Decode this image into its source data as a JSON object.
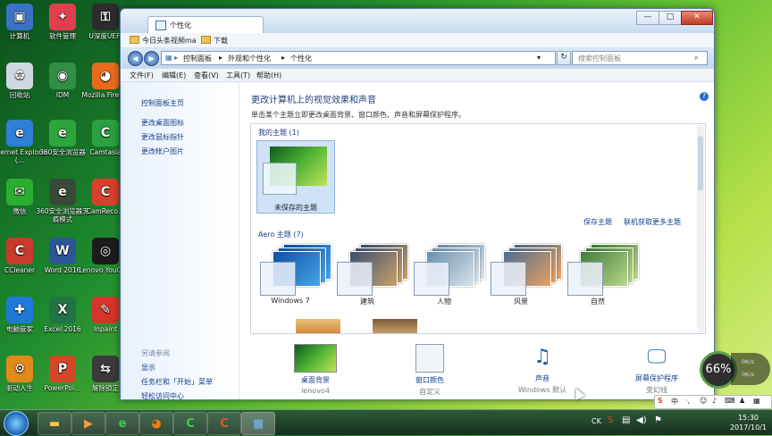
{
  "desktop_icons": [
    {
      "label": "计算机",
      "icon": "computer-icon",
      "color": "#3a72c5",
      "glyph": "▣"
    },
    {
      "label": "软件管理",
      "icon": "software-manager-icon",
      "color": "#e0404c",
      "glyph": "✦"
    },
    {
      "label": "U深度UEFI",
      "icon": "usb-icon",
      "color": "#2c2c2c",
      "glyph": "⚿"
    },
    {
      "label": "回收站",
      "icon": "recycle-bin-icon",
      "color": "#cfd8e0",
      "glyph": "♻"
    },
    {
      "label": "IDM",
      "icon": "idm-icon",
      "color": "#2f8f43",
      "glyph": "◉"
    },
    {
      "label": "Mozilla Firefox",
      "icon": "firefox-icon",
      "color": "#e86a1d",
      "glyph": "◕"
    },
    {
      "label": "Internet Explorer (…",
      "icon": "ie-icon",
      "color": "#2f7fd6",
      "glyph": "e"
    },
    {
      "label": "360安全浏览器",
      "icon": "browser-360-icon",
      "color": "#2ea43c",
      "glyph": "e"
    },
    {
      "label": "Camtasia",
      "icon": "camtasia-icon",
      "color": "#2ba040",
      "glyph": "C"
    },
    {
      "label": "微信",
      "icon": "wechat-icon",
      "color": "#2aae30",
      "glyph": "✉"
    },
    {
      "label": "360安全浏览器无痕模式",
      "icon": "browser-360-private-icon",
      "color": "#3a4a3a",
      "glyph": "e"
    },
    {
      "label": "CamReco…",
      "icon": "camrecorder-icon",
      "color": "#d9402b",
      "glyph": "C"
    },
    {
      "label": "CCleaner",
      "icon": "ccleaner-icon",
      "color": "#c83a2a",
      "glyph": "C"
    },
    {
      "label": "Word 2016",
      "icon": "word-icon",
      "color": "#2b579a",
      "glyph": "W"
    },
    {
      "label": "Lenovo YouCam",
      "icon": "youcam-icon",
      "color": "#1c1c1c",
      "glyph": "◎"
    },
    {
      "label": "电脑管家",
      "icon": "pc-manager-icon",
      "color": "#1e7ad6",
      "glyph": "✚"
    },
    {
      "label": "Excel 2016",
      "icon": "excel-icon",
      "color": "#217346",
      "glyph": "X"
    },
    {
      "label": "Inpaint",
      "icon": "inpaint-icon",
      "color": "#d6332b",
      "glyph": "✎"
    },
    {
      "label": "驱动人生",
      "icon": "driver-icon",
      "color": "#e08a1a",
      "glyph": "⚙"
    },
    {
      "label": "PowerPoi…",
      "icon": "powerpoint-icon",
      "color": "#d24726",
      "glyph": "P"
    },
    {
      "label": "解除锁定",
      "icon": "unlock-arrows-icon",
      "color": "#3a3a3a",
      "glyph": "⇆"
    }
  ],
  "window": {
    "tab_title": "个性化",
    "controls": {
      "minimize": "—",
      "maximize": "□",
      "close": "✕"
    },
    "bookmarks": [
      "今日头条视频ma",
      "下载"
    ],
    "address": [
      "控制面板",
      "外观和个性化",
      "个性化"
    ],
    "search_placeholder": "搜索控制面板",
    "menu": [
      "文件(F)",
      "编辑(E)",
      "查看(V)",
      "工具(T)",
      "帮助(H)"
    ],
    "left_links": [
      "控制面板主页",
      "更改桌面图标",
      "更改鼠标指针",
      "更改帐户图片"
    ],
    "see_also_title": "另请参阅",
    "see_also": [
      "显示",
      "任务栏和「开始」菜单",
      "轻松访问中心"
    ],
    "heading": "更改计算机上的视觉效果和声音",
    "subheading": "单击某个主题立即更改桌面背景、窗口颜色、声音和屏幕保护程序。",
    "my_themes_title": "我的主题 (1)",
    "my_themes": [
      {
        "label": "未保存的主题"
      }
    ],
    "save_theme": "保存主题",
    "get_more": "联机获取更多主题",
    "aero_title": "Aero 主题 (7)",
    "aero_themes": [
      {
        "label": "Windows 7",
        "colors": [
          "#0b4fa6",
          "#49a4e8"
        ]
      },
      {
        "label": "建筑",
        "colors": [
          "#3a4f6e",
          "#c9a06a"
        ]
      },
      {
        "label": "人物",
        "colors": [
          "#6a8fb0",
          "#d8e3e8"
        ]
      },
      {
        "label": "风景",
        "colors": [
          "#4c6d8f",
          "#e8a060"
        ]
      },
      {
        "label": "自然",
        "colors": [
          "#3f7a3a",
          "#b9d98a"
        ]
      }
    ],
    "bottom_items": [
      {
        "label": "桌面背景",
        "value": "lenovo4",
        "icon": "desktop-background-icon"
      },
      {
        "label": "窗口颜色",
        "value": "自定义",
        "icon": "window-color-icon"
      },
      {
        "label": "声音",
        "value": "Windows 默认",
        "icon": "sound-icon"
      },
      {
        "label": "屏幕保护程序",
        "value": "变幻线",
        "icon": "screensaver-icon"
      }
    ]
  },
  "system": {
    "gauge_percent": "66%",
    "net_up": "0K/s",
    "net_down": "0K/s",
    "ime_label": "中",
    "lang": "CK",
    "time": "15:30",
    "date": "2017/10/1"
  }
}
